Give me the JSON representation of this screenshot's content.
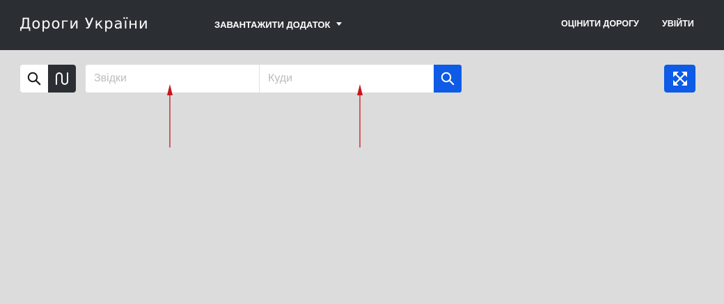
{
  "header": {
    "brand": "Дороги України",
    "download_menu_label": "ЗАВАНТАЖИТИ ДОДАТОК",
    "rate_road_label": "ОЦІНИТИ ДОРОГУ",
    "login_label": "УВІЙТИ"
  },
  "toolbar": {
    "mode_buttons": [
      {
        "name": "search",
        "icon": "search-icon",
        "active": false
      },
      {
        "name": "route",
        "icon": "route-icon",
        "active": true
      }
    ],
    "from_input": {
      "placeholder": "Звідки",
      "value": ""
    },
    "to_input": {
      "placeholder": "Куди",
      "value": ""
    },
    "submit_icon": "search-icon",
    "fullscreen_icon": "expand-icon"
  },
  "colors": {
    "navbar": "#2b2e33",
    "accent": "#0d5be6",
    "map_background": "#dcdcdc",
    "annotation_arrow": "#c8161d"
  }
}
